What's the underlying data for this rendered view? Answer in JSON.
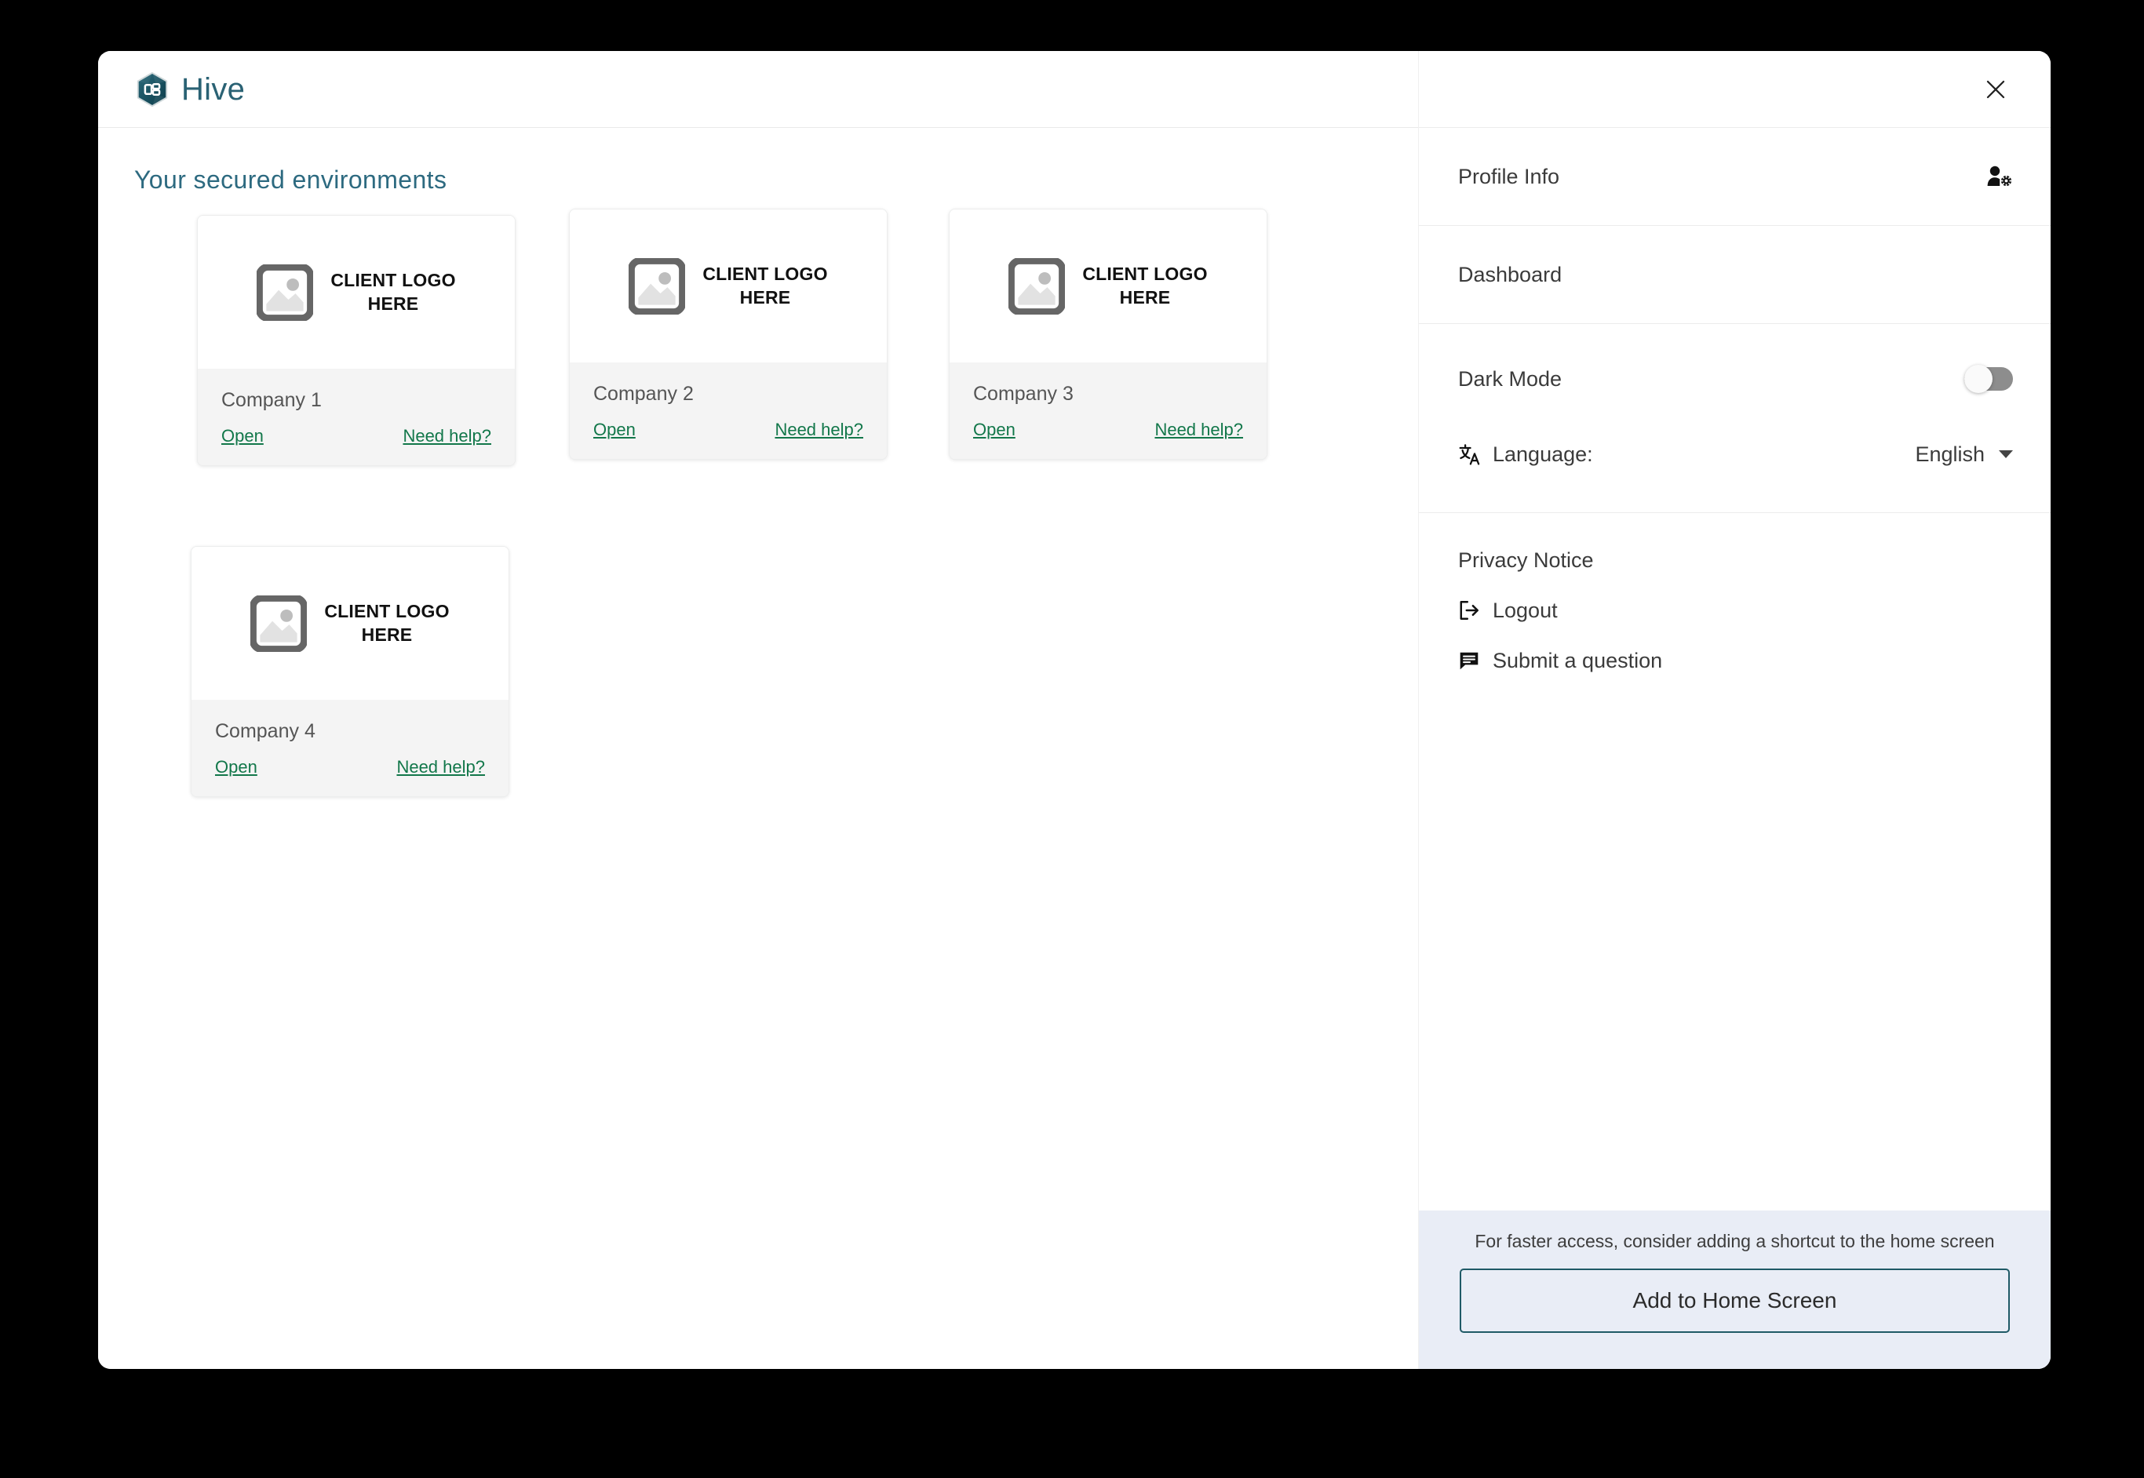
{
  "app": {
    "brand_name": "Hive",
    "logo_icon": "hive-hexagon-logo"
  },
  "main": {
    "section_title": "Your secured environments",
    "card_logo_placeholder_text": "CLIENT LOGO\nHERE",
    "cards": [
      {
        "company": "Company 1",
        "open_label": "Open",
        "help_label": "Need help?"
      },
      {
        "company": "Company 2",
        "open_label": "Open",
        "help_label": "Need help?"
      },
      {
        "company": "Company 3",
        "open_label": "Open",
        "help_label": "Need help?"
      },
      {
        "company": "Company 4",
        "open_label": "Open",
        "help_label": "Need help?"
      }
    ]
  },
  "panel": {
    "close_icon": "close-icon",
    "profile": {
      "label": "Profile Info",
      "icon": "user-settings-icon"
    },
    "dashboard": {
      "label": "Dashboard"
    },
    "dark_mode": {
      "label": "Dark Mode",
      "state": "off"
    },
    "language": {
      "label": "Language:",
      "value": "English",
      "icon": "translate-icon"
    },
    "links": [
      {
        "label": "Privacy Notice",
        "icon": ""
      },
      {
        "label": "Logout",
        "icon": "logout-icon"
      },
      {
        "label": "Submit a question",
        "icon": "message-icon"
      }
    ],
    "footer": {
      "note": "For faster access, consider adding a shortcut to the home screen",
      "button_label": "Add to Home Screen"
    }
  },
  "colors": {
    "brand_teal": "#2a6274",
    "heading_teal": "#2d6a80",
    "link_green": "#12774a",
    "footer_bg": "#e9edf6",
    "button_border": "#1f5a66",
    "card_bottom_bg": "#f4f4f4"
  }
}
